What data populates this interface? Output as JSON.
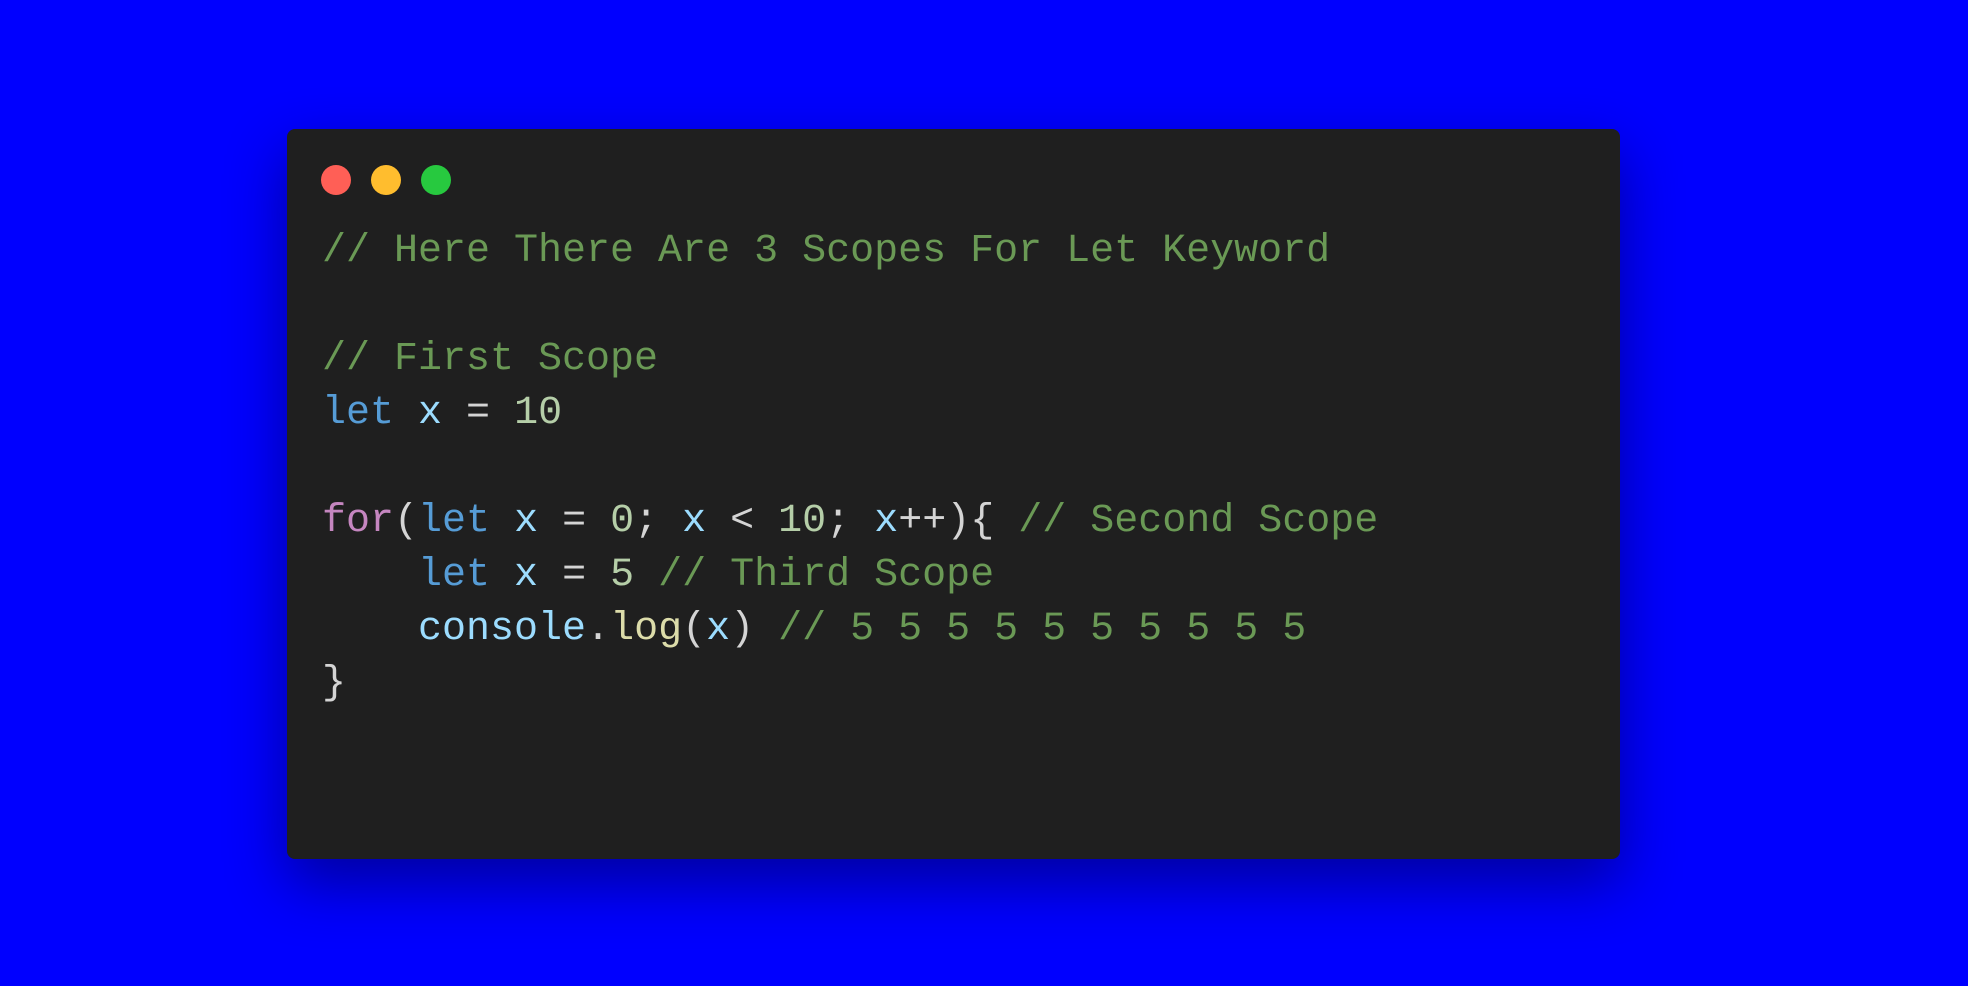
{
  "colors": {
    "background": "#0000ff",
    "window": "#1f1f1f",
    "close": "#ff5f56",
    "minimize": "#ffbd2e",
    "maximize": "#27c93f",
    "comment": "#6a9955",
    "keyword": "#569cd6",
    "control": "#c586c0",
    "variable": "#9cdcfe",
    "number": "#b5cea8",
    "function": "#dcdcaa",
    "plain": "#d4d4d4"
  },
  "window_controls": [
    "close-button",
    "minimize-button",
    "maximize-button"
  ],
  "code": {
    "lines": [
      [
        {
          "t": "// Here There Are 3 Scopes For Let Keyword",
          "k": "comment"
        }
      ],
      [],
      [
        {
          "t": "// First Scope",
          "k": "comment"
        }
      ],
      [
        {
          "t": "let",
          "k": "keyword"
        },
        {
          "t": " ",
          "k": "plain"
        },
        {
          "t": "x",
          "k": "variable"
        },
        {
          "t": " = ",
          "k": "operator"
        },
        {
          "t": "10",
          "k": "number"
        }
      ],
      [],
      [
        {
          "t": "for",
          "k": "control"
        },
        {
          "t": "(",
          "k": "punct"
        },
        {
          "t": "let",
          "k": "keyword"
        },
        {
          "t": " ",
          "k": "plain"
        },
        {
          "t": "x",
          "k": "variable"
        },
        {
          "t": " = ",
          "k": "operator"
        },
        {
          "t": "0",
          "k": "number"
        },
        {
          "t": "; ",
          "k": "punct"
        },
        {
          "t": "x",
          "k": "variable"
        },
        {
          "t": " < ",
          "k": "operator"
        },
        {
          "t": "10",
          "k": "number"
        },
        {
          "t": "; ",
          "k": "punct"
        },
        {
          "t": "x",
          "k": "variable"
        },
        {
          "t": "++){ ",
          "k": "punct"
        },
        {
          "t": "// Second Scope",
          "k": "comment"
        }
      ],
      [
        {
          "t": "    ",
          "k": "plain"
        },
        {
          "t": "let",
          "k": "keyword"
        },
        {
          "t": " ",
          "k": "plain"
        },
        {
          "t": "x",
          "k": "variable"
        },
        {
          "t": " = ",
          "k": "operator"
        },
        {
          "t": "5",
          "k": "number"
        },
        {
          "t": " ",
          "k": "plain"
        },
        {
          "t": "// Third Scope",
          "k": "comment"
        }
      ],
      [
        {
          "t": "    ",
          "k": "plain"
        },
        {
          "t": "console",
          "k": "variable"
        },
        {
          "t": ".",
          "k": "punct"
        },
        {
          "t": "log",
          "k": "function"
        },
        {
          "t": "(",
          "k": "punct"
        },
        {
          "t": "x",
          "k": "variable"
        },
        {
          "t": ") ",
          "k": "punct"
        },
        {
          "t": "// 5 5 5 5 5 5 5 5 5 5",
          "k": "comment"
        }
      ],
      [
        {
          "t": "}",
          "k": "punct"
        }
      ]
    ]
  }
}
